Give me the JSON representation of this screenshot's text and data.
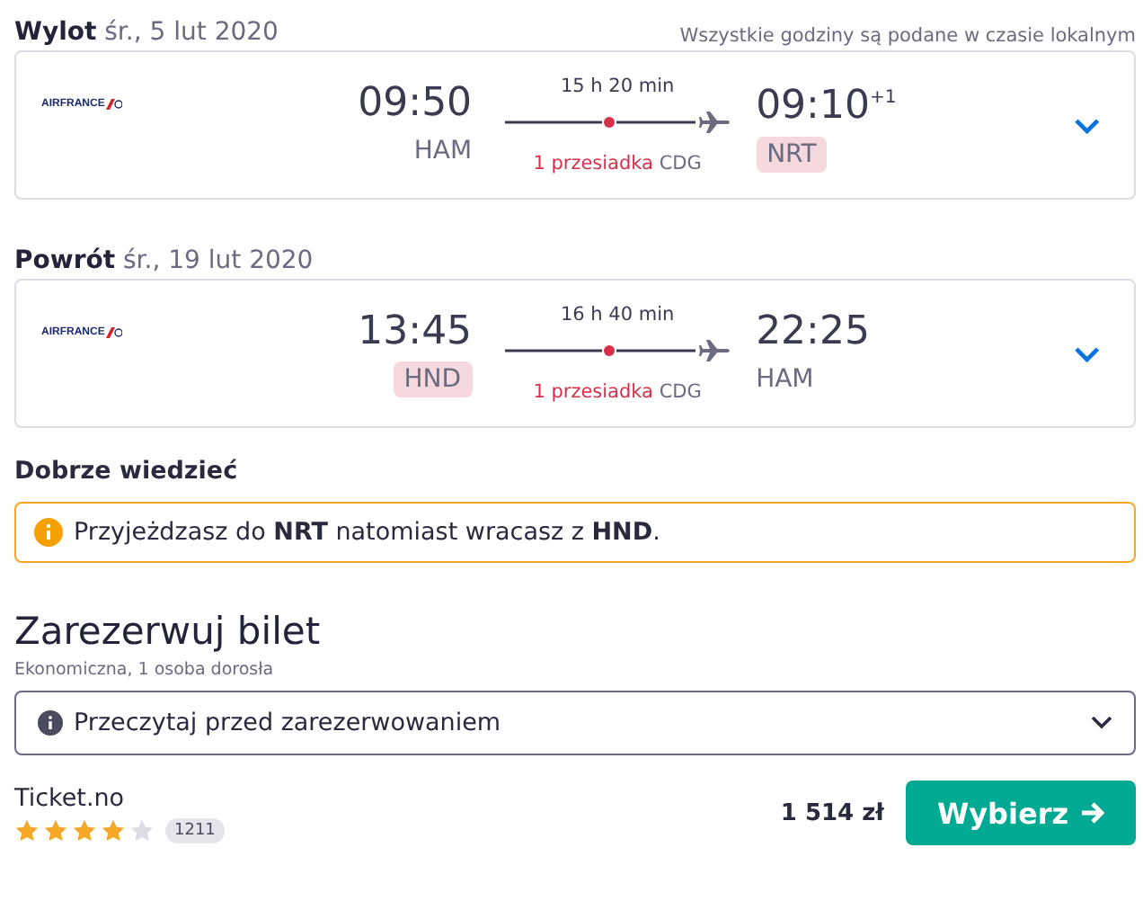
{
  "header_note": "Wszystkie godziny są podane w czasie lokalnym",
  "legs": [
    {
      "label": "Wylot",
      "date": "śr., 5 lut 2020",
      "airline": "AIRFRANCE",
      "dep_time": "09:50",
      "dep_airport": "HAM",
      "dep_highlight": false,
      "duration": "15 h 20 min",
      "stops": "1 przesiadka",
      "via": "CDG",
      "arr_time": "09:10",
      "arr_offset": "+1",
      "arr_airport": "NRT",
      "arr_highlight": true,
      "expanded": false
    },
    {
      "label": "Powrót",
      "date": "śr., 19 lut 2020",
      "airline": "AIRFRANCE",
      "dep_time": "13:45",
      "dep_airport": "HND",
      "dep_highlight": true,
      "duration": "16 h 40 min",
      "stops": "1 przesiadka",
      "via": "CDG",
      "arr_time": "22:25",
      "arr_airport": "HAM",
      "arr_highlight": false,
      "expanded": false
    }
  ],
  "good_to_know": {
    "title": "Dobrze wiedzieć",
    "notice": "Przyjeżdzasz do **NRT** natomiast wracasz z **HND**."
  },
  "booking": {
    "title": "Zarezerwuj bilet",
    "subtitle": "Ekonomiczna, 1 osoba dorosła",
    "dropdown": "Przeczytaj przed zarezerwowaniem",
    "provider": "Ticket.no",
    "stars": 4,
    "reviews": "1211",
    "price": "1 514 zł",
    "button": "Wybierz"
  }
}
